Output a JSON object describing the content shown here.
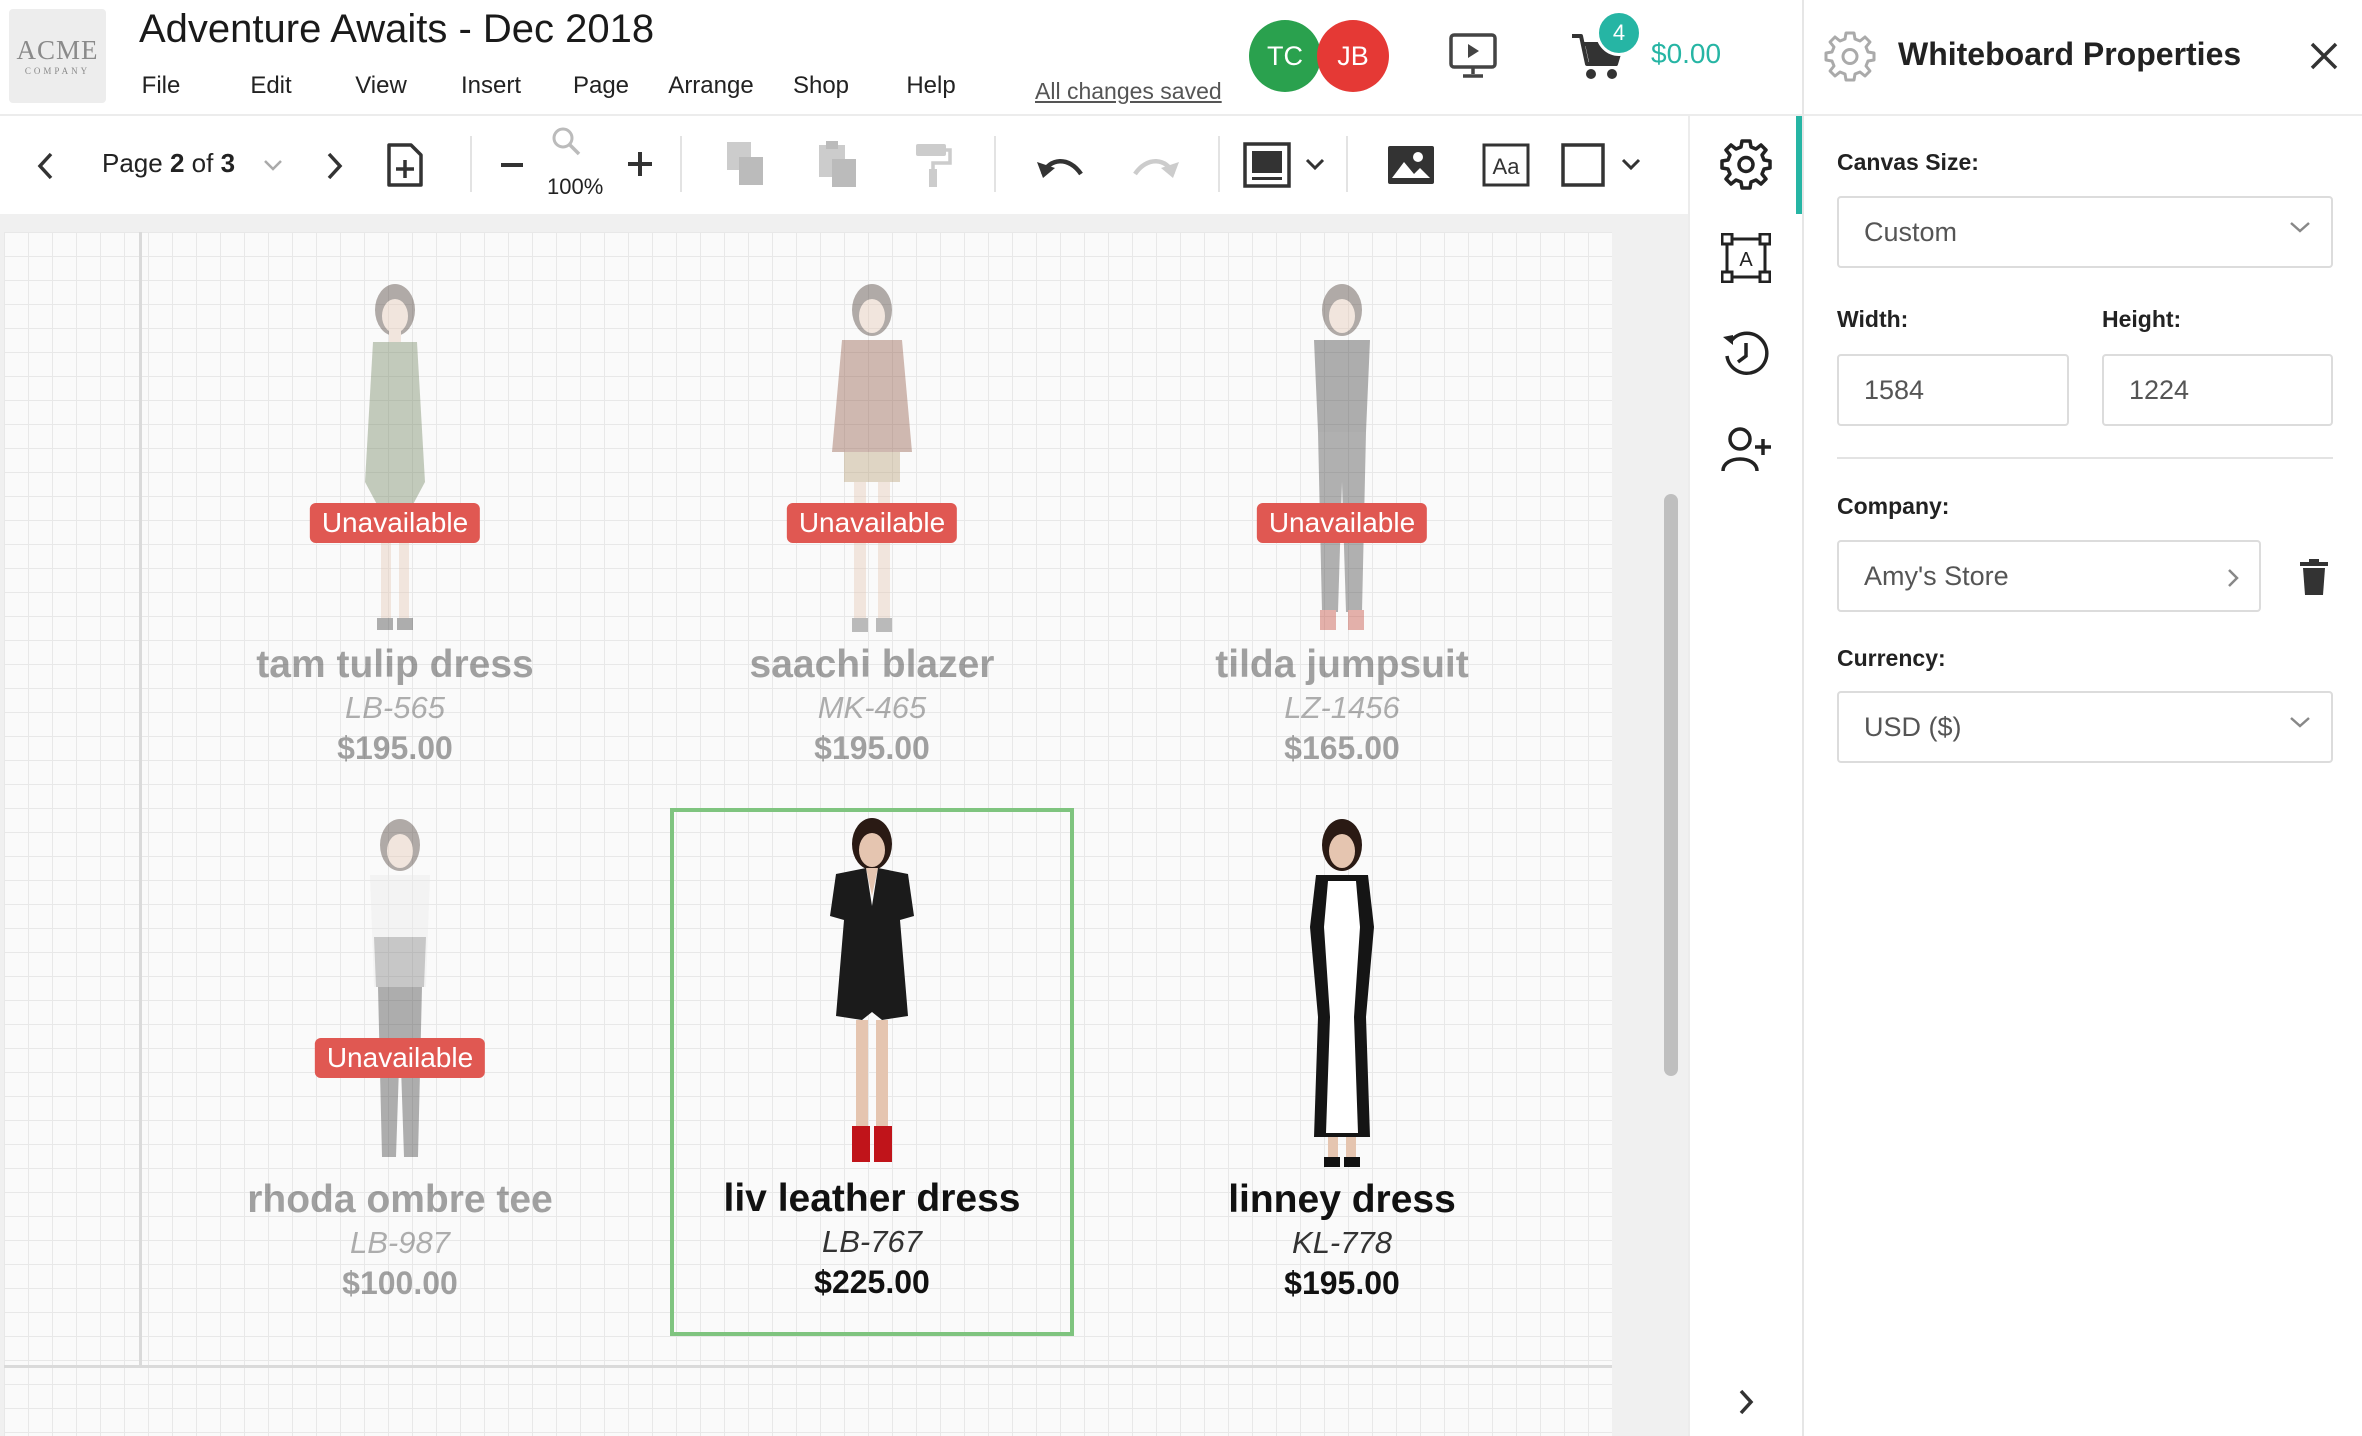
{
  "header": {
    "logo_line1": "ACME",
    "logo_line2": "COMPANY",
    "title": "Adventure Awaits - Dec 2018",
    "menu": [
      "File",
      "Edit",
      "View",
      "Insert",
      "Page",
      "Arrange",
      "Shop",
      "Help"
    ],
    "save_status": "All changes saved",
    "collaborators": [
      {
        "initials": "TC",
        "color": "#2aa14e"
      },
      {
        "initials": "JB",
        "color": "#e53935"
      }
    ],
    "cart_count": "4",
    "cart_total": "$0.00"
  },
  "toolbar": {
    "page_prefix": "Page ",
    "page_current": "2",
    "page_of": " of ",
    "page_total": "3",
    "zoom": "100%"
  },
  "canvas": {
    "products": [
      {
        "name": "tam tulip dress",
        "sku": "LB-565",
        "price": "$195.00",
        "status": "Unavailable",
        "available": false
      },
      {
        "name": "saachi blazer",
        "sku": "MK-465",
        "price": "$195.00",
        "status": "Unavailable",
        "available": false
      },
      {
        "name": "tilda jumpsuit",
        "sku": "LZ-1456",
        "price": "$165.00",
        "status": "Unavailable",
        "available": false
      },
      {
        "name": "rhoda ombre tee",
        "sku": "LB-987",
        "price": "$100.00",
        "status": "Unavailable",
        "available": false
      },
      {
        "name": "liv leather dress",
        "sku": "LB-767",
        "price": "$225.00",
        "status": "",
        "available": true,
        "selected": true
      },
      {
        "name": "linney dress",
        "sku": "KL-778",
        "price": "$195.00",
        "status": "",
        "available": true
      }
    ]
  },
  "panel": {
    "title": "Whiteboard Properties",
    "canvas_size_label": "Canvas Size:",
    "canvas_size_value": "Custom",
    "width_label": "Width:",
    "width_value": "1584",
    "height_label": "Height:",
    "height_value": "1224",
    "company_label": "Company:",
    "company_value": "Amy's Store",
    "currency_label": "Currency:",
    "currency_value": "USD ($)"
  },
  "colors": {
    "accent": "#26b5a4",
    "unavailable_badge": "#e05852",
    "selection": "#7fc47f"
  }
}
